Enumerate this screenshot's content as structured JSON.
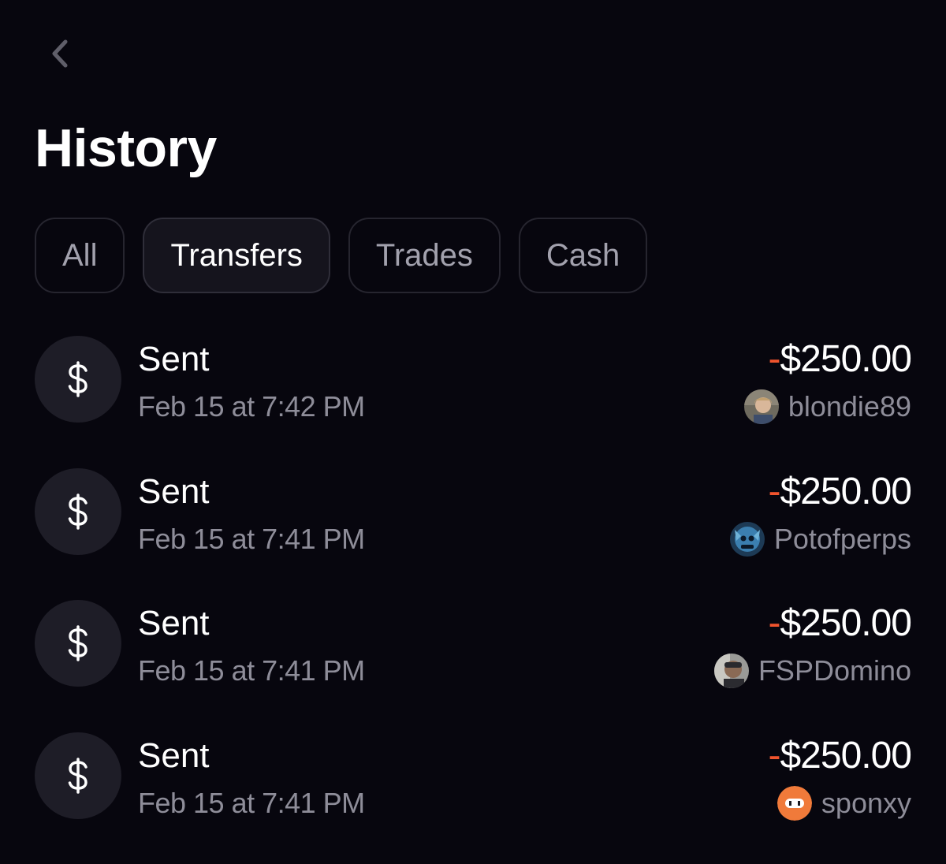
{
  "header": {
    "back_icon": "chevron-left-icon",
    "title": "History"
  },
  "tabs": [
    {
      "label": "All",
      "active": false
    },
    {
      "label": "Transfers",
      "active": true
    },
    {
      "label": "Trades",
      "active": false
    },
    {
      "label": "Cash",
      "active": false
    }
  ],
  "colors": {
    "background": "#07060e",
    "negative": "#f0542d",
    "muted_text": "#8e8d99"
  },
  "transactions": [
    {
      "icon": "dollar-icon",
      "title": "Sent",
      "date": "Feb 15 at 7:42 PM",
      "sign": "-",
      "amount": "$250.00",
      "username": "blondie89"
    },
    {
      "icon": "dollar-icon",
      "title": "Sent",
      "date": "Feb 15 at 7:41 PM",
      "sign": "-",
      "amount": "$250.00",
      "username": "Potofperps"
    },
    {
      "icon": "dollar-icon",
      "title": "Sent",
      "date": "Feb 15 at 7:41 PM",
      "sign": "-",
      "amount": "$250.00",
      "username": "FSPDomino"
    },
    {
      "icon": "dollar-icon",
      "title": "Sent",
      "date": "Feb 15 at 7:41 PM",
      "sign": "-",
      "amount": "$250.00",
      "username": "sponxy"
    }
  ]
}
